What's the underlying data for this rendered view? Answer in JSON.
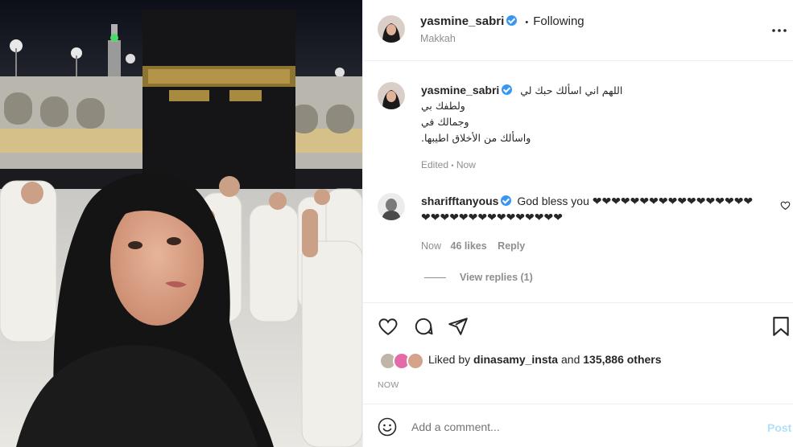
{
  "header": {
    "username": "yasmine_sabri",
    "separator": "•",
    "follow_status": "Following",
    "location": "Makkah",
    "more_icon": "more-horizontal-icon"
  },
  "caption": {
    "username": "yasmine_sabri",
    "lines": [
      "اللهم اني اسألك حبك لي",
      "ولطفك بي",
      "وجمالك في",
      "واسألك من الأخلاق اطيبها."
    ],
    "meta_edited": "Edited",
    "meta_sep": "•",
    "meta_time": "Now"
  },
  "comment": {
    "username": "sharifftanyous",
    "text_line1": "God bless you ❤❤❤❤❤❤❤❤❤❤❤❤❤❤❤❤❤",
    "text_line2": "❤❤❤❤❤❤❤❤❤❤❤❤❤❤❤",
    "time": "Now",
    "likes": "46 likes",
    "reply": "Reply",
    "view_replies": "View replies (1)"
  },
  "actions": {
    "like_icon": "heart-icon",
    "comment_icon": "comment-icon",
    "share_icon": "share-icon",
    "save_icon": "bookmark-icon",
    "liked_by_prefix": "Liked by",
    "liked_by_user": "dinasamy_insta",
    "liked_by_and": "and",
    "liked_by_others": "135,886 others",
    "timestamp": "NOW"
  },
  "add_comment": {
    "emoji_icon": "smiley-icon",
    "placeholder": "Add a comment...",
    "post_label": "Post"
  },
  "colors": {
    "verified": "#3897f0",
    "post_disabled": "#b2dffc",
    "muted": "#8e8e8e",
    "border": "#efefef"
  }
}
